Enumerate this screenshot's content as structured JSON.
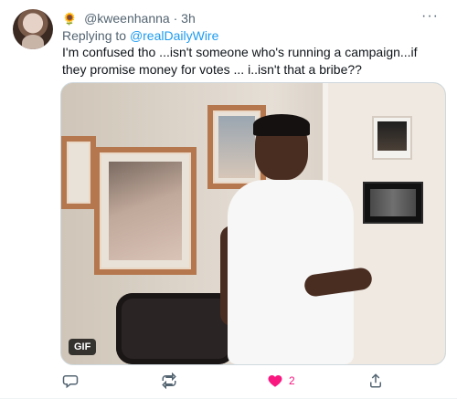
{
  "tweet": {
    "user_emoji": "🌻",
    "handle": "@kweenhanna",
    "dot": "·",
    "time": "3h",
    "more": "···",
    "replying_to_prefix": "Replying to ",
    "replying_to_user": "@realDailyWire",
    "text": "I'm confused tho ...isn't someone who's running a campaign...if they promise money for votes ... i..isn't that a bribe??"
  },
  "media": {
    "badge": "GIF"
  },
  "actions": {
    "like_count": "2"
  },
  "icons": {
    "reply": "reply-icon",
    "retweet": "retweet-icon",
    "like": "heart-icon",
    "share": "share-icon",
    "more": "more-icon"
  },
  "colors": {
    "link": "#1d9bf0",
    "muted": "#536471",
    "like": "#f91880"
  }
}
